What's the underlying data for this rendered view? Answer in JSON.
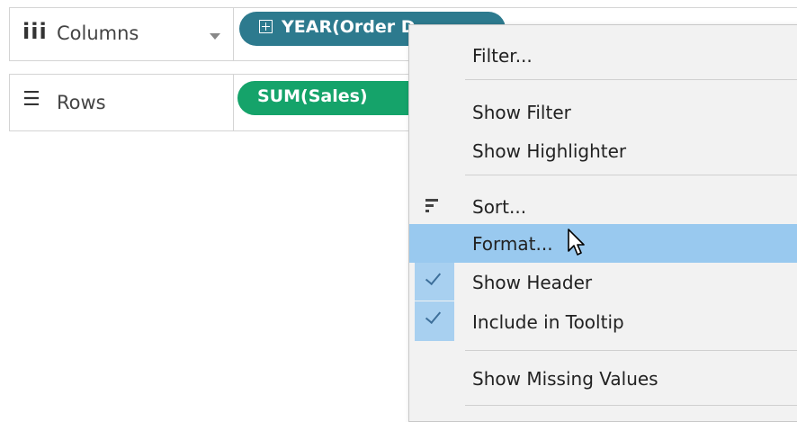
{
  "shelves": {
    "columns": {
      "icon": "columns-icon",
      "label": "Columns",
      "pill": "YEAR(Order D"
    },
    "rows": {
      "icon": "rows-icon",
      "label": "Rows",
      "pill": "SUM(Sales)"
    }
  },
  "colors": {
    "columns_pill": "#2d7a8e",
    "rows_pill": "#15a36a",
    "menu_highlight": "#99c9ef",
    "menu_background": "#f2f2f2"
  },
  "context_menu": {
    "items": [
      {
        "label": "Filter..."
      },
      {
        "label": "Show Filter"
      },
      {
        "label": "Show Highlighter"
      },
      {
        "label": "Sort...",
        "icon": "sort-icon"
      },
      {
        "label": "Format...",
        "highlighted": true
      },
      {
        "label": "Show Header",
        "checked": true
      },
      {
        "label": "Include in Tooltip",
        "checked": true
      },
      {
        "label": "Show Missing Values"
      }
    ]
  }
}
